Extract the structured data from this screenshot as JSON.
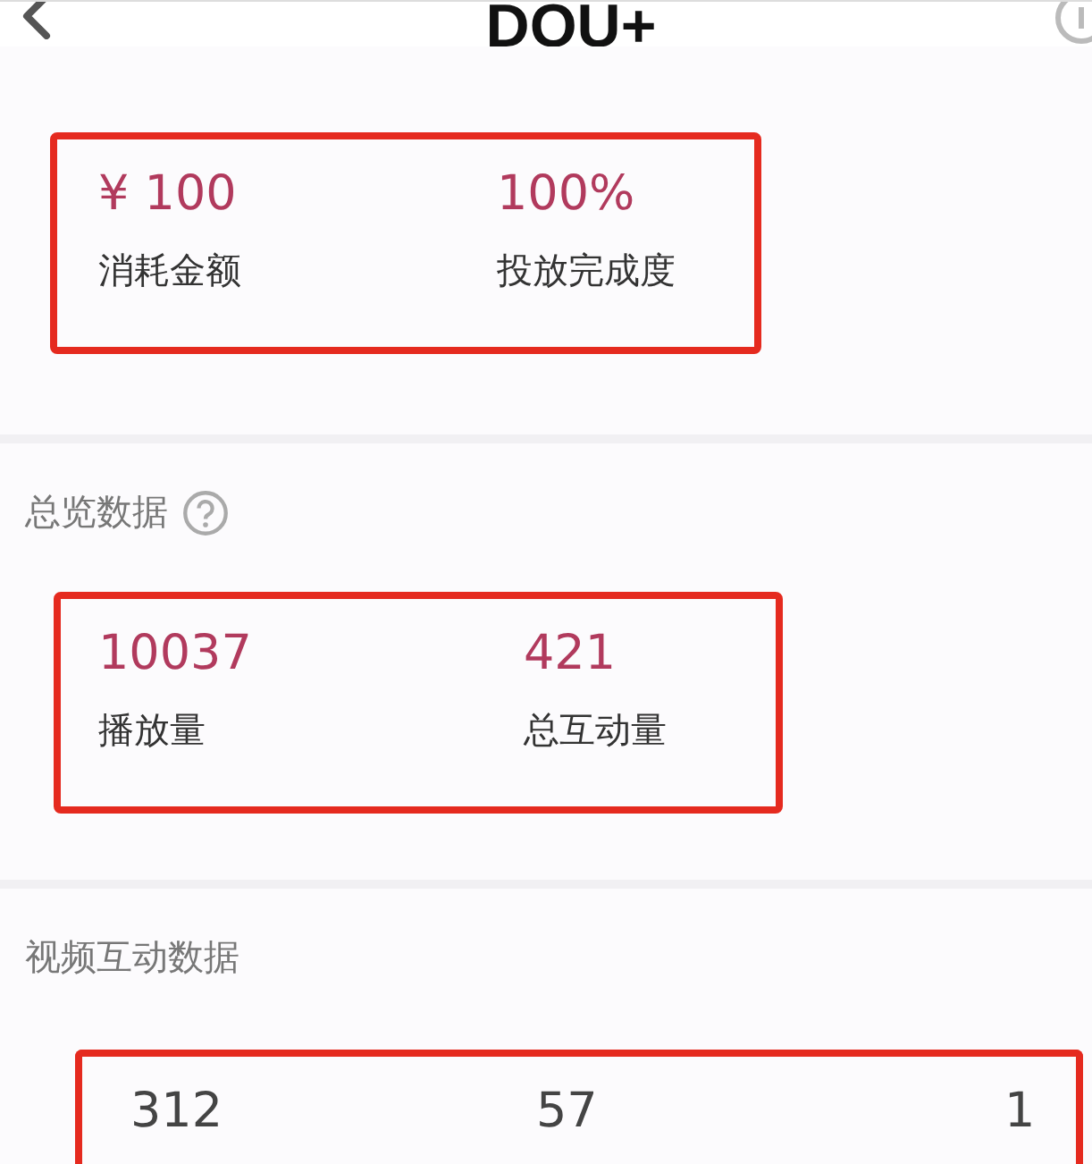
{
  "header": {
    "title": "DOU+"
  },
  "sections": [
    {
      "kind": "summary",
      "metrics": [
        {
          "value": "¥ 100",
          "label": "消耗金额"
        },
        {
          "value": "100%",
          "label": "投放完成度"
        }
      ]
    },
    {
      "kind": "summary",
      "title": "总览数据",
      "help": true,
      "metrics": [
        {
          "value": "10037",
          "label": "播放量"
        },
        {
          "value": "421",
          "label": "总互动量"
        }
      ]
    },
    {
      "kind": "interaction",
      "title": "视频互动数据",
      "help": false,
      "metrics": [
        {
          "value": "312"
        },
        {
          "value": "57"
        },
        {
          "value": "1"
        }
      ]
    }
  ]
}
